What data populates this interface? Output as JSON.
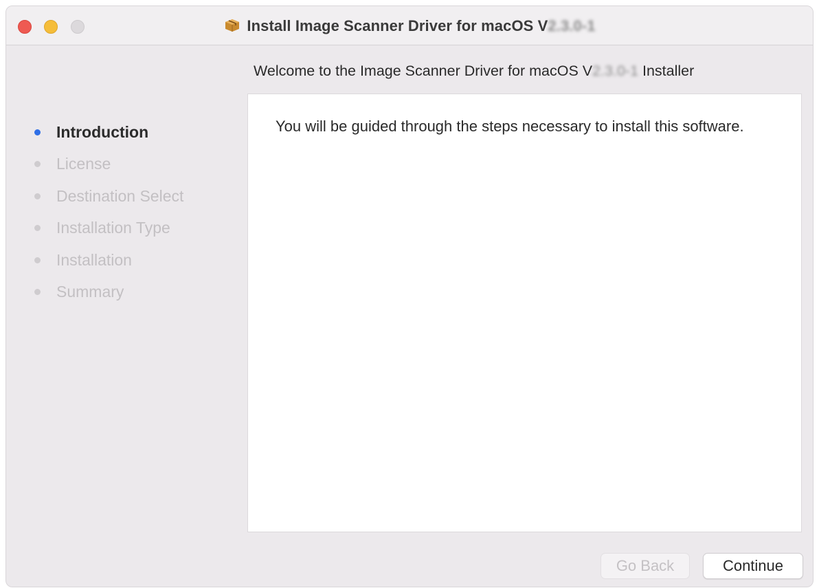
{
  "window": {
    "title_prefix": "Install Image Scanner Driver for macOS V",
    "title_version_blurred": "2.3.0-1"
  },
  "sidebar": {
    "steps": [
      {
        "label": "Introduction",
        "active": true
      },
      {
        "label": "License",
        "active": false
      },
      {
        "label": "Destination Select",
        "active": false
      },
      {
        "label": "Installation Type",
        "active": false
      },
      {
        "label": "Installation",
        "active": false
      },
      {
        "label": "Summary",
        "active": false
      }
    ]
  },
  "main": {
    "heading_prefix": "Welcome to the Image Scanner Driver for macOS V",
    "heading_version_blurred": "2.3.0-1",
    "heading_suffix": " Installer",
    "body_text": "You will be guided through the steps necessary to install this software."
  },
  "buttons": {
    "go_back_label": "Go Back",
    "continue_label": "Continue"
  },
  "colors": {
    "active_step": "#2f6fe6",
    "close": "#ee5a52",
    "minimize": "#f5bd3a",
    "zoom_disabled": "#dcd9dc"
  }
}
